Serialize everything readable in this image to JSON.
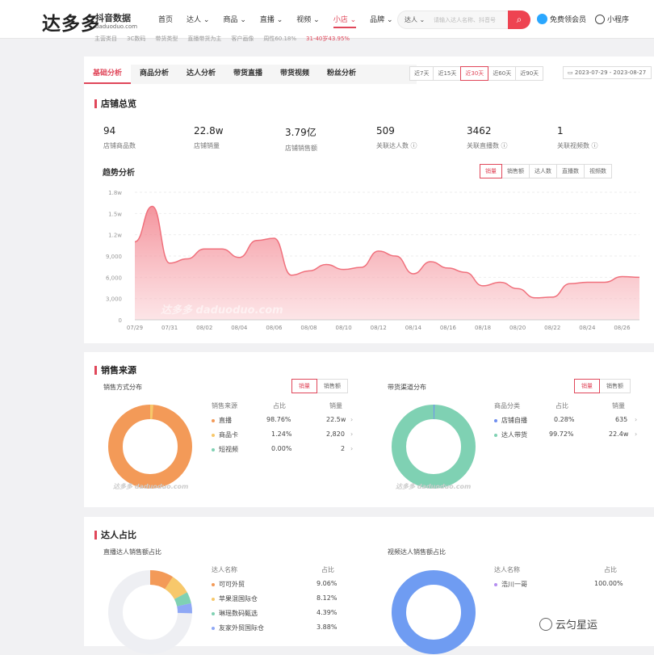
{
  "header": {
    "logo": "达多多",
    "logo_sub": "抖音数据",
    "logo_domain": "daduoduo.com",
    "nav": [
      "首页",
      "达人",
      "商品",
      "直播",
      "视频",
      "小店",
      "品牌"
    ],
    "search_type": "达人",
    "search_placeholder": "请输入达人名称、抖音号",
    "member": "免费领会员",
    "mini": "小程序"
  },
  "strip": [
    "主营类目",
    "3C数码",
    "带货类型",
    "直播带货为主",
    "客户画像",
    "周性60.18%",
    "31-40岁43.95%"
  ],
  "tabs": [
    "基础分析",
    "商品分析",
    "达人分析",
    "带货直播",
    "带货视频",
    "粉丝分析"
  ],
  "days": [
    "近7天",
    "近15天",
    "近30天",
    "近60天",
    "近90天"
  ],
  "date_range": "2023-07-29 - 2023-08-27",
  "overview": {
    "title": "店铺总览",
    "stats": [
      {
        "value": "94",
        "label": "店铺商品数"
      },
      {
        "value": "22.8w",
        "label": "店铺销量"
      },
      {
        "value": "3.79亿",
        "label": "店铺销售额"
      },
      {
        "value": "509",
        "label": "关联达人数 ⓘ"
      },
      {
        "value": "3462",
        "label": "关联直播数 ⓘ"
      },
      {
        "value": "1",
        "label": "关联视频数 ⓘ"
      }
    ],
    "trend_title": "趋势分析",
    "metric_tabs": [
      "销量",
      "销售额",
      "达人数",
      "直播数",
      "视频数"
    ]
  },
  "chart_data": {
    "type": "area",
    "x": [
      "07/29",
      "07/30",
      "07/31",
      "08/01",
      "08/02",
      "08/03",
      "08/04",
      "08/05",
      "08/06",
      "08/07",
      "08/08",
      "08/09",
      "08/10",
      "08/11",
      "08/12",
      "08/13",
      "08/14",
      "08/15",
      "08/16",
      "08/17",
      "08/18",
      "08/19",
      "08/20",
      "08/21",
      "08/22",
      "08/23",
      "08/24",
      "08/25",
      "08/26",
      "08/27"
    ],
    "values": [
      11000,
      16000,
      8000,
      8600,
      10000,
      10000,
      8800,
      11200,
      11500,
      6300,
      6900,
      7800,
      7100,
      7400,
      9700,
      9000,
      6500,
      8200,
      7300,
      6700,
      4800,
      5300,
      4400,
      3100,
      3200,
      5100,
      5300,
      5300,
      6100,
      6000
    ],
    "ylim": [
      0,
      18000
    ],
    "yticks": [
      "0",
      "3,000",
      "6,000",
      "9,000",
      "1.2w",
      "1.5w",
      "1.8w"
    ],
    "xticks": [
      "07/29",
      "07/31",
      "08/02",
      "08/04",
      "08/06",
      "08/08",
      "08/10",
      "08/12",
      "08/14",
      "08/16",
      "08/18",
      "08/20",
      "08/22",
      "08/24",
      "08/26"
    ],
    "color": "#f0707c",
    "watermark": "达多多 daduoduo.com"
  },
  "sales": {
    "title": "销售来源",
    "left": {
      "subtitle": "销售方式分布",
      "toggle": [
        "销量",
        "销售额"
      ],
      "headers": [
        "销售来源",
        "占比",
        "销量"
      ],
      "rows": [
        {
          "name": "直播",
          "pct": "98.76%",
          "val": "22.5w",
          "color": "#f39a58"
        },
        {
          "name": "商品卡",
          "pct": "1.24%",
          "val": "2,820",
          "color": "#f7c86b"
        },
        {
          "name": "短视频",
          "pct": "0.00%",
          "val": "2",
          "color": "#7fd1b3"
        }
      ]
    },
    "right": {
      "subtitle": "带货渠道分布",
      "toggle": [
        "销量",
        "销售额"
      ],
      "headers": [
        "商品分类",
        "占比",
        "销量"
      ],
      "rows": [
        {
          "name": "店铺自播",
          "pct": "0.28%",
          "val": "635",
          "color": "#6f8ff0"
        },
        {
          "name": "达人带货",
          "pct": "99.72%",
          "val": "22.4w",
          "color": "#7fd1b3"
        }
      ]
    }
  },
  "talent": {
    "title": "达人占比",
    "left": {
      "subtitle": "直播达人销售额占比",
      "headers": [
        "达人名称",
        "占比"
      ],
      "rows": [
        {
          "name": "可可外贸",
          "pct": "9.06%",
          "color": "#f39a58"
        },
        {
          "name": "苹果混国际仓",
          "pct": "8.12%",
          "color": "#f7c86b"
        },
        {
          "name": "琳瑶数码甄选",
          "pct": "4.39%",
          "color": "#7fd1b3"
        },
        {
          "name": "友家外贸国际仓",
          "pct": "3.88%",
          "color": "#8fa8f5"
        }
      ]
    },
    "right": {
      "subtitle": "视频达人销售额占比",
      "headers": [
        "达人名称",
        "占比"
      ],
      "rows": [
        {
          "name": "浩川一哥",
          "pct": "100.00%",
          "color": "#b58ef0"
        }
      ]
    }
  },
  "corner_text": "云匀星运"
}
